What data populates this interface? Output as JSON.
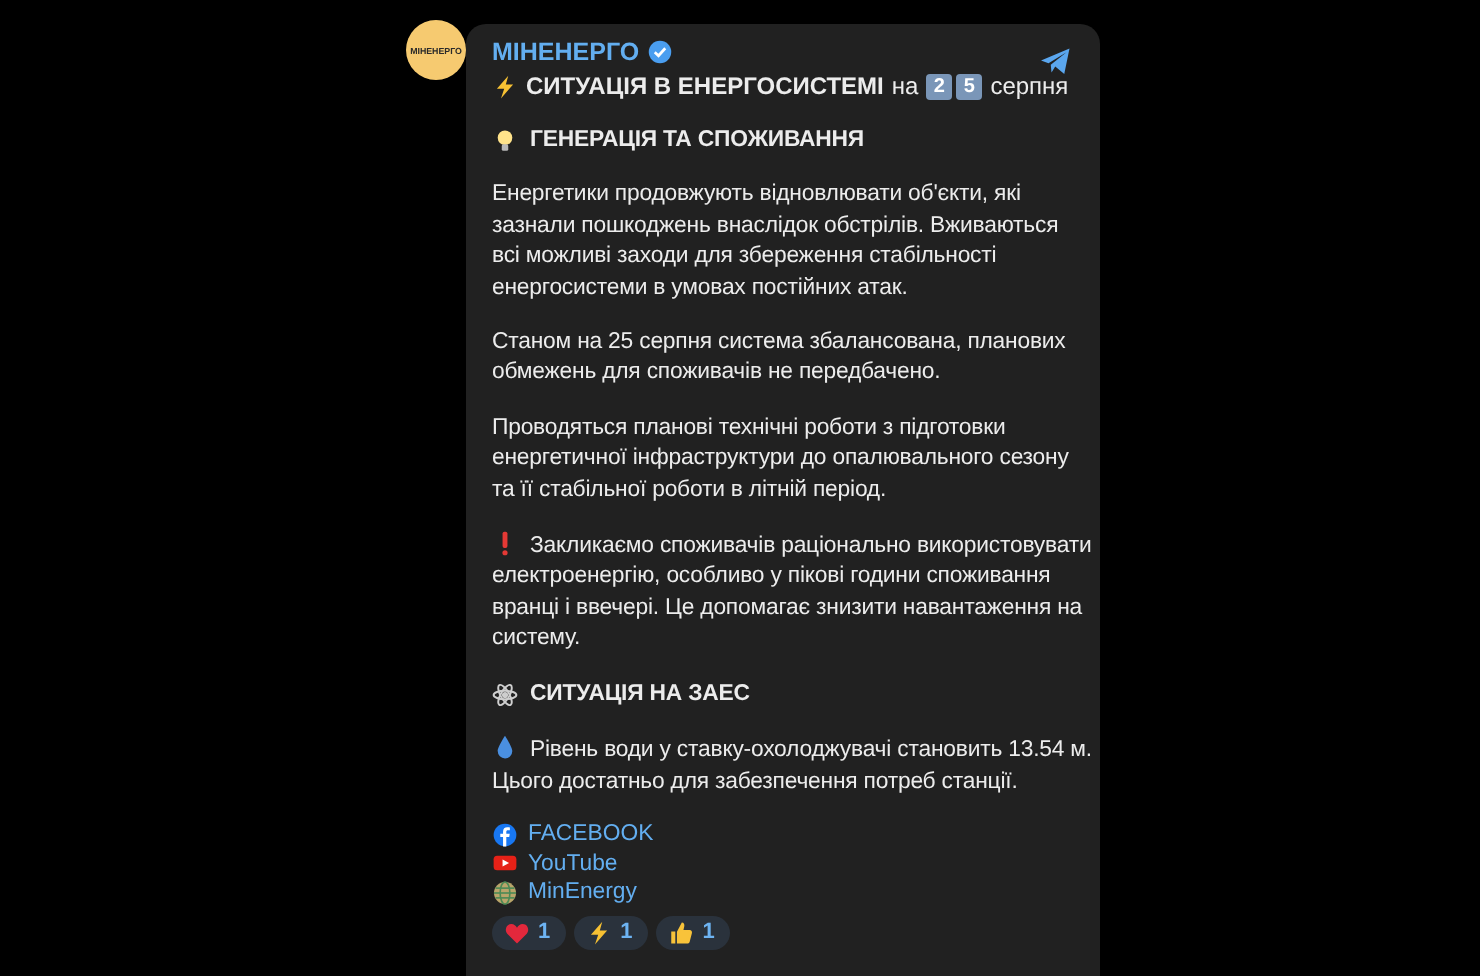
{
  "channel": {
    "avatar_text": "МІНЕНЕРГО",
    "name": "МІНЕНЕРГО",
    "verified": true
  },
  "title": {
    "headline": "СИТУАЦІЯ В ЕНЕРГОСИСТЕМІ",
    "middle": "на",
    "keycaps": [
      "2",
      "5"
    ],
    "tail": "серпня"
  },
  "blocks": [
    {
      "kind": "heading",
      "text": "ГЕНЕРАЦІЯ ТА СПОЖИВАННЯ"
    },
    {
      "kind": "paragraph",
      "text": "Енергетики продовжують відновлювати об'єкти, які зазнали пошкоджень внаслідок обстрілів. Вживаються всі можливі заходи для збереження стабільності енергосистеми в умовах постійних атак."
    },
    {
      "kind": "paragraph",
      "text": "Станом на 25 серпня система збалансована, планових обмежень для споживачів не передбачено."
    },
    {
      "kind": "paragraph",
      "text": "Проводяться планові технічні роботи з підготовки енергетичної інфраструктури до опалювального сезону та її стабільної роботи в літній період."
    },
    {
      "kind": "paragraph",
      "text": "Закликаємо споживачів раціонально використовувати електроенергію, особливо у пікові години споживання вранці і ввечері. Це допомагає знизити навантаження на систему."
    },
    {
      "kind": "heading",
      "text": "СИТУАЦІЯ НА ЗАЕС"
    },
    {
      "kind": "paragraph",
      "text": "Рівень води у ставку-охолоджувачі становить 13.54 м. Цього достатньо для забезпечення потреб станції."
    }
  ],
  "links": [
    {
      "text": "FACEBOOK"
    },
    {
      "text": "YouTube"
    },
    {
      "text": "MinEnergy"
    }
  ],
  "reactions": [
    {
      "count": "1"
    },
    {
      "count": "1"
    },
    {
      "count": "1"
    }
  ]
}
